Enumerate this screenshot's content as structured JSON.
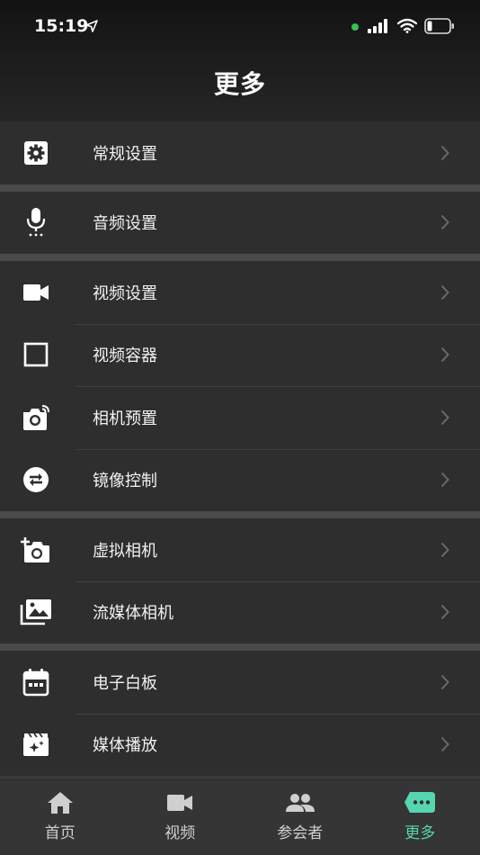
{
  "status_bar": {
    "time": "15:19"
  },
  "header": {
    "title": "更多"
  },
  "groups": [
    [
      {
        "label": "常规设置",
        "icon": "gear-icon"
      }
    ],
    [
      {
        "label": "音频设置",
        "icon": "microphone-icon"
      }
    ],
    [
      {
        "label": "视频设置",
        "icon": "video-camera-icon"
      },
      {
        "label": "视频容器",
        "icon": "square-outline-icon"
      },
      {
        "label": "相机预置",
        "icon": "camera-preset-icon"
      },
      {
        "label": "镜像控制",
        "icon": "swap-arrows-icon"
      }
    ],
    [
      {
        "label": "虚拟相机",
        "icon": "add-camera-icon"
      },
      {
        "label": "流媒体相机",
        "icon": "photo-library-icon"
      }
    ],
    [
      {
        "label": "电子白板",
        "icon": "calendar-board-icon"
      },
      {
        "label": "媒体播放",
        "icon": "clapperboard-icon"
      }
    ]
  ],
  "tabs": [
    {
      "label": "首页",
      "icon": "home-icon",
      "active": false
    },
    {
      "label": "视频",
      "icon": "video-icon",
      "active": false
    },
    {
      "label": "参会者",
      "icon": "participants-icon",
      "active": false
    },
    {
      "label": "更多",
      "icon": "more-chat-icon",
      "active": true
    }
  ],
  "colors": {
    "accent": "#55d6b0",
    "background": "#2e2e2e",
    "signal_dot": "#36c05a"
  }
}
